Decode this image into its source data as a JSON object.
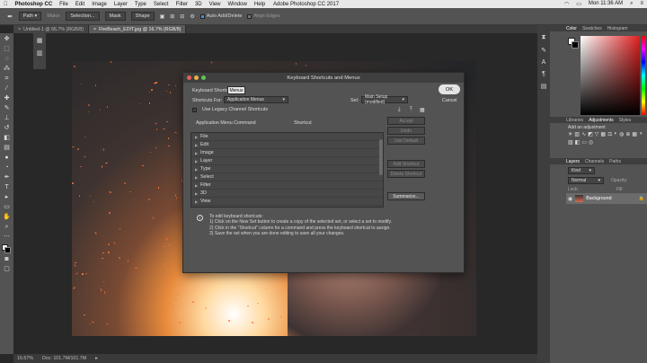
{
  "menubar": {
    "app": "Photoshop CC",
    "items": [
      "File",
      "Edit",
      "Image",
      "Layer",
      "Type",
      "Select",
      "Filter",
      "3D",
      "View",
      "Window",
      "Help"
    ],
    "window_title": "Adobe Photoshop CC 2017",
    "clock": "Mon 11:36 AM"
  },
  "options": {
    "path_select": "Path",
    "make": "Make:",
    "selection": "Selection...",
    "mask": "Mask",
    "shape": "Shape",
    "auto_add_delete": "Auto Add/Delete",
    "align_edges": "Align Edges"
  },
  "tabs": [
    {
      "label": "Untitled-1 @ 66.7% (RGB/8)",
      "close": "×"
    },
    {
      "label": "FireBeach_EDIT.jpg @ 16.7% (RGB/8)",
      "close": "×"
    }
  ],
  "status": {
    "zoom": "16.67%",
    "doc": "Doc: 101.7M/101.7M"
  },
  "panels": {
    "color_tabs": [
      "Color",
      "Swatches",
      "Histogram"
    ],
    "adj_tabs": [
      "Libraries",
      "Adjustments",
      "Styles"
    ],
    "add_adjustment": "Add an adjustment",
    "layer_tabs": [
      "Layers",
      "Channels",
      "Paths"
    ],
    "layer_kind": "Kind",
    "blend_mode": "Normal",
    "opacity": "Opacity:",
    "lock": "Lock:",
    "fill": "Fill:",
    "layer_name": "Background"
  },
  "dialog": {
    "title": "Keyboard Shortcuts and Menus",
    "tab_shortcuts": "Keyboard Shortcuts",
    "tab_menus": "Menus",
    "shortcuts_for_label": "Shortcuts For:",
    "shortcuts_for_value": "Application Menus",
    "set_label": "Set:",
    "set_value": "Main Setup (modified)",
    "legacy_label": "Use Legacy Channel Shortcuts",
    "col_command": "Application Menu Command",
    "col_shortcut": "Shortcut",
    "ok": "OK",
    "cancel": "Cancel",
    "accept": "Accept",
    "undo": "Undo",
    "use_default": "Use Default",
    "add_shortcut": "Add Shortcut",
    "delete_shortcut": "Delete Shortcut",
    "summarize": "Summarize...",
    "menu_items": [
      "File",
      "Edit",
      "Image",
      "Layer",
      "Type",
      "Select",
      "Filter",
      "3D",
      "View"
    ],
    "info_title": "To edit keyboard shortcuts:",
    "info_lines": [
      "1) Click on the New Set button to create a copy of the selected set, or select a set to modify.",
      "2) Click in the \"Shortcut\" column for a command and press the keyboard shortcut to assign.",
      "3) Save the set when you are done editing to save all your changes."
    ]
  },
  "colors": {
    "accent": "#4a90d9",
    "close": "#ec5f57",
    "min": "#e3b341",
    "max": "#5fc454"
  }
}
